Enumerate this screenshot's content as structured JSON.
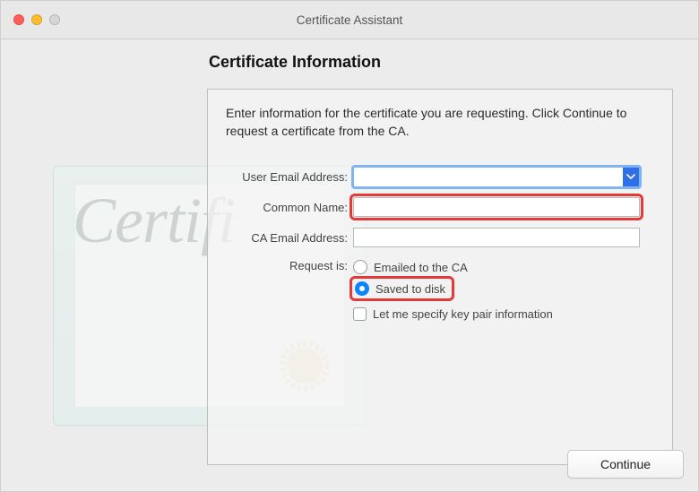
{
  "window": {
    "title": "Certificate Assistant"
  },
  "panel": {
    "title": "Certificate Information",
    "intro": "Enter information for the certificate you are requesting. Click Continue to request a certificate from the CA."
  },
  "form": {
    "user_email": {
      "label": "User Email Address:",
      "value": "",
      "placeholder": ""
    },
    "common_name": {
      "label": "Common Name:",
      "value": ""
    },
    "ca_email": {
      "label": "CA Email Address:",
      "value": ""
    },
    "request_is": {
      "label": "Request is:",
      "options": {
        "emailed": "Emailed to the CA",
        "saved": "Saved to disk"
      },
      "selected": "saved"
    },
    "specify_keypair": {
      "label": "Let me specify key pair information",
      "checked": false
    }
  },
  "buttons": {
    "continue": "Continue"
  },
  "cert_graphic": {
    "script_text": "Certifi"
  }
}
